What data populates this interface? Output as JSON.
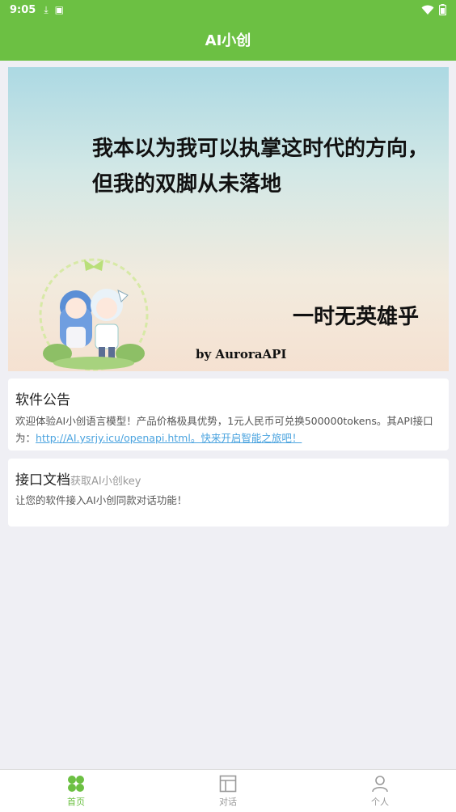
{
  "status": {
    "time": "9:05",
    "icons": [
      "download-icon",
      "app-icon",
      "wifi-icon",
      "battery-icon"
    ]
  },
  "header": {
    "title": "AI小创"
  },
  "banner": {
    "line1": "我本以为我可以执掌这时代的方向，",
    "line2": "但我的双脚从未落地",
    "right_text": "一时无英雄乎",
    "byline": "by AuroraAPI"
  },
  "notice": {
    "heading": "软件公告",
    "text": "欢迎体验AI小创语言模型！产品价格极具优势，1元人民币可兑换500000tokens。其API接口为：",
    "link": "http://AI.ysrjy.icu/openapi.html。快来开启智能之旅吧！"
  },
  "docs": {
    "heading": "接口文档",
    "sub": "获取AI小创key",
    "text": "让您的软件接入AI小创同款对话功能！"
  },
  "tabs": [
    {
      "label": "首页",
      "icon": "home-icon",
      "active": true
    },
    {
      "label": "对话",
      "icon": "chat-icon",
      "active": false
    },
    {
      "label": "个人",
      "icon": "person-icon",
      "active": false
    }
  ],
  "colors": {
    "accent": "#6cc043",
    "link": "#4aa3df",
    "background": "#efeff4"
  }
}
